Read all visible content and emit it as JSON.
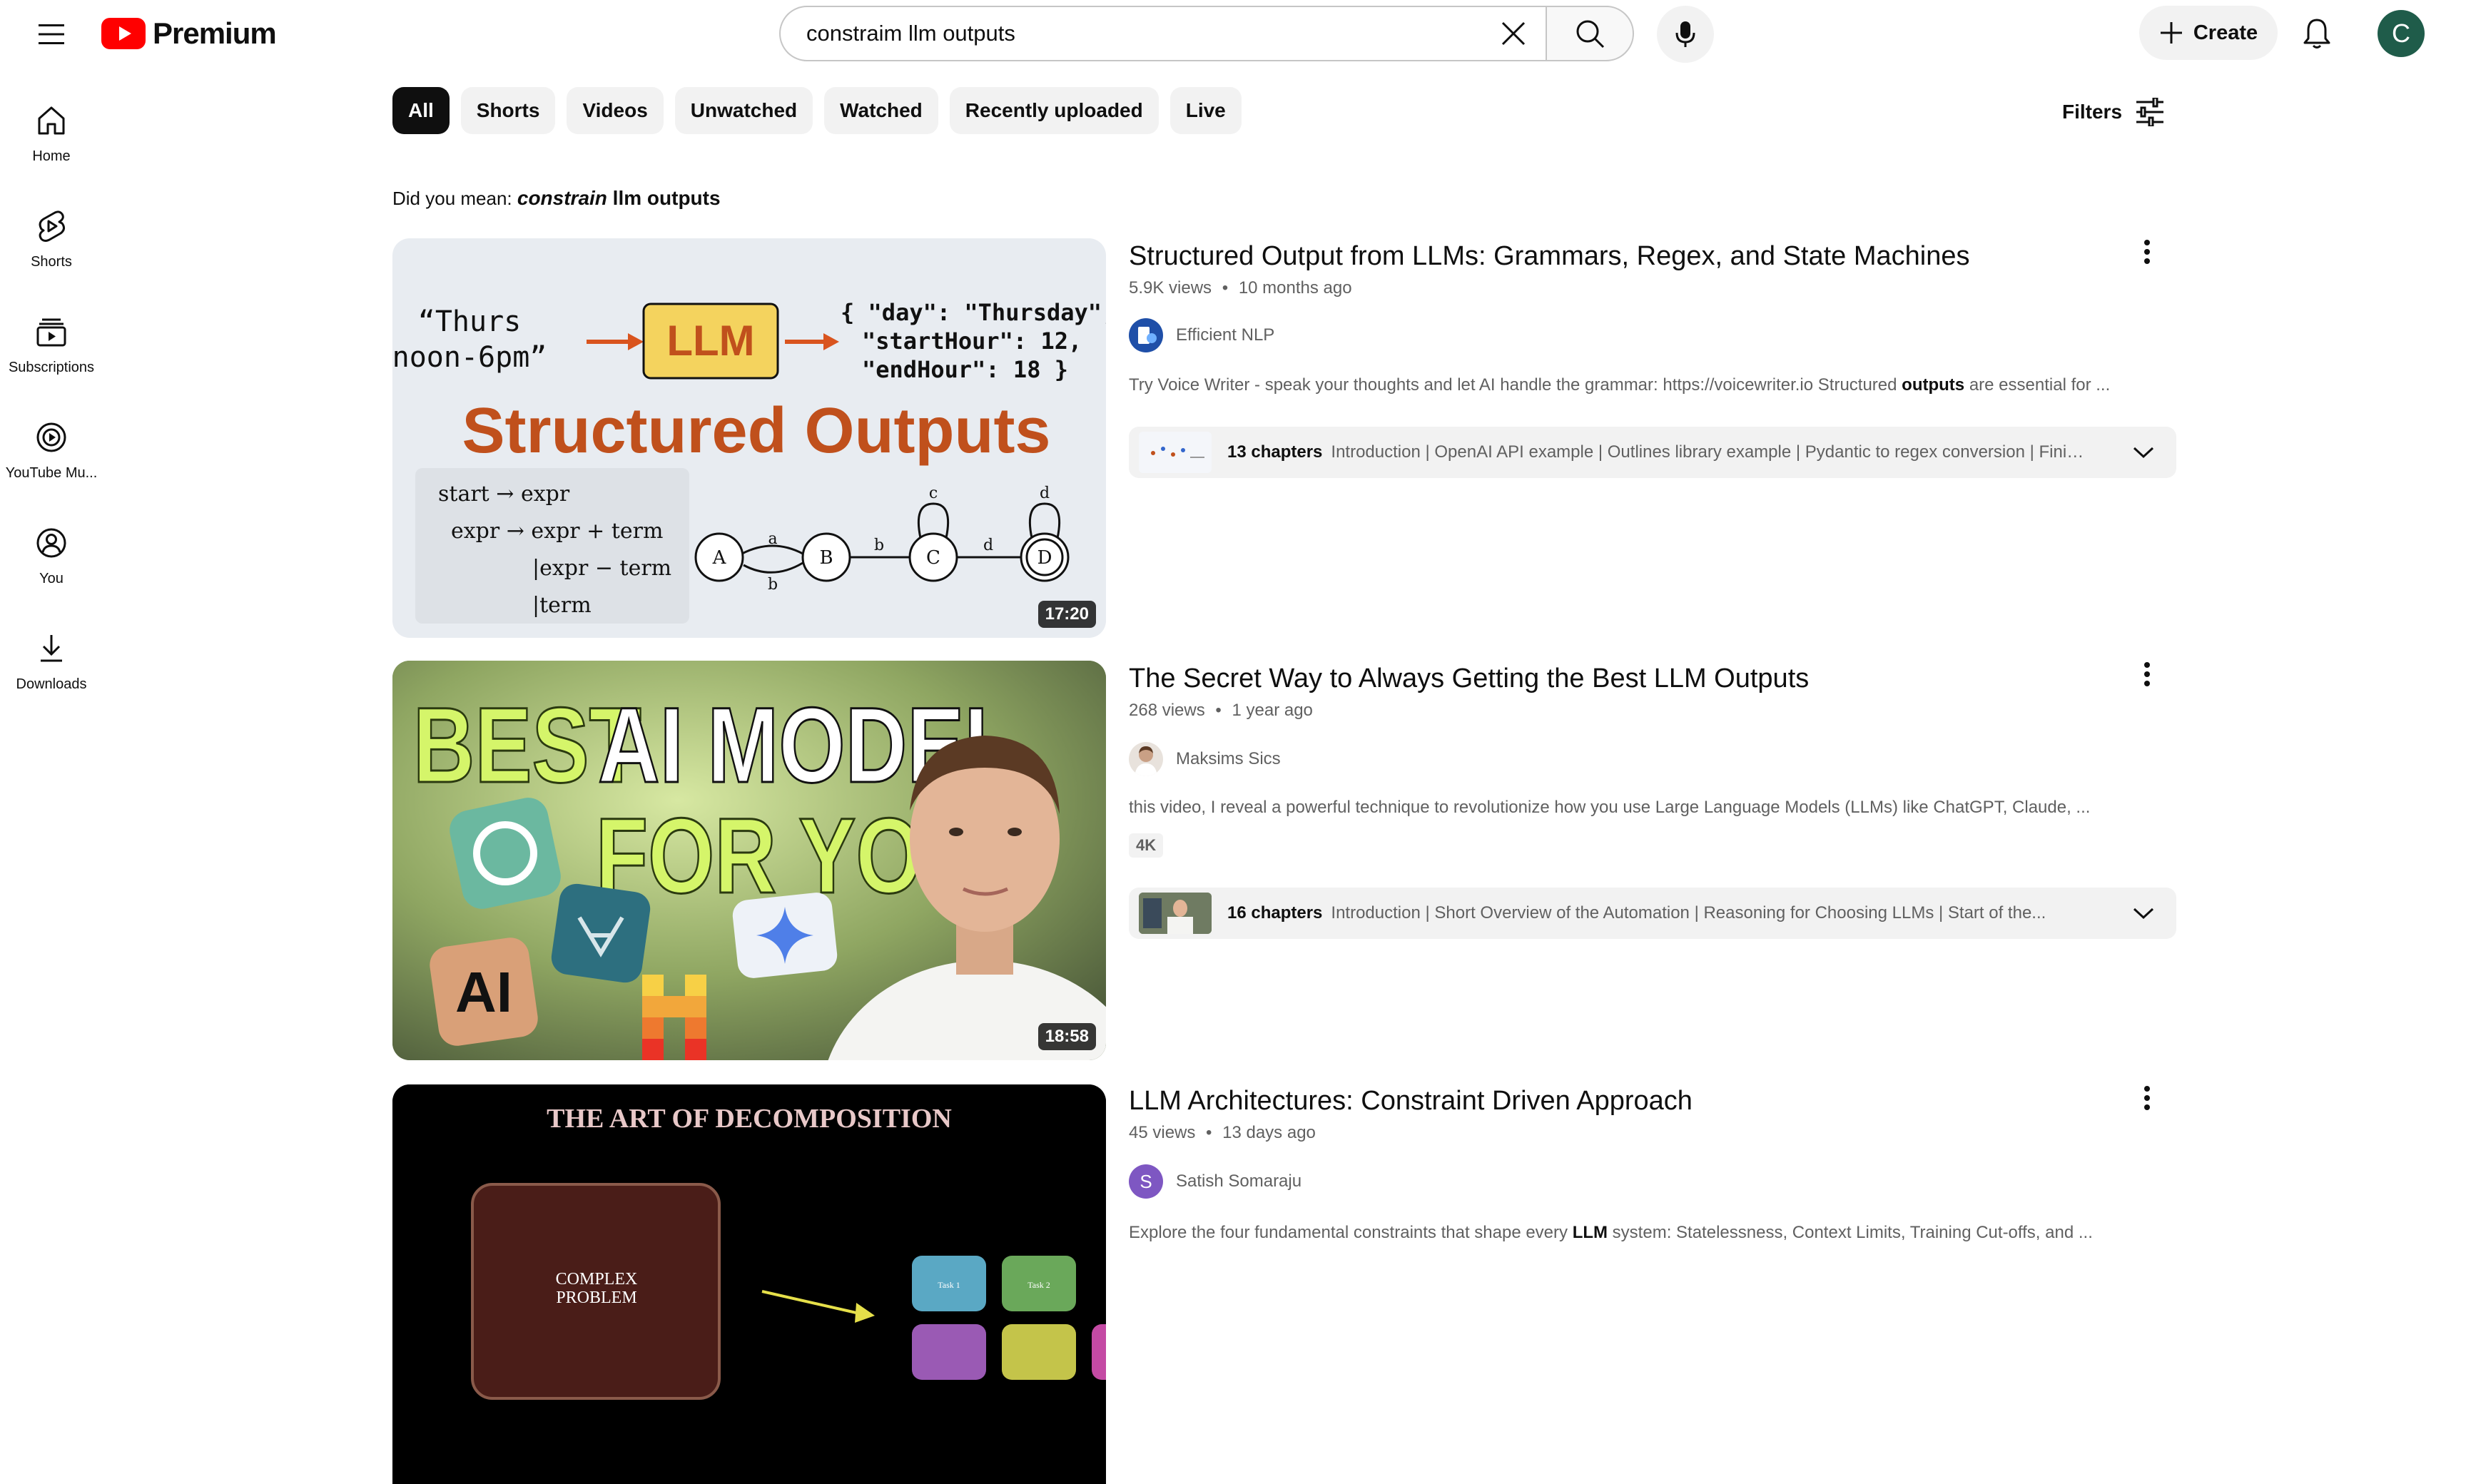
{
  "header": {
    "brand": "Premium",
    "search_value": "constraim llm outputs",
    "create_label": "Create",
    "avatar_letter": "C",
    "accent_red": "#ff0000"
  },
  "sidebar": {
    "items": [
      {
        "label": "Home",
        "icon": "home-icon"
      },
      {
        "label": "Shorts",
        "icon": "shorts-icon"
      },
      {
        "label": "Subscriptions",
        "icon": "subscriptions-icon"
      },
      {
        "label": "YouTube Mu...",
        "icon": "youtube-music-icon"
      },
      {
        "label": "You",
        "icon": "you-icon"
      },
      {
        "label": "Downloads",
        "icon": "download-icon"
      }
    ]
  },
  "chips": [
    "All",
    "Shorts",
    "Videos",
    "Unwatched",
    "Watched",
    "Recently uploaded",
    "Live"
  ],
  "filters_label": "Filters",
  "did_you_mean": {
    "prefix": "Did you mean: ",
    "corrected": "constrain",
    "rest": " llm outputs"
  },
  "results": [
    {
      "title": "Structured Output from LLMs: Grammars, Regex, and State Machines",
      "views": "5.9K views",
      "age": "10 months ago",
      "channel": "Efficient NLP",
      "desc_before": "Try Voice Writer - speak your thoughts and let AI handle the grammar: https://voicewriter.io Structured ",
      "desc_bold": "outputs",
      "desc_after": " are essential for ...",
      "duration": "17:20",
      "chapters_count": "13 chapters",
      "chapters_list": "Introduction | OpenAI API example | Outlines library example | Pydantic to regex conversion | Finite...",
      "thumb": {
        "quote_line1": "“Thurs",
        "quote_line2": "noon-6pm”",
        "llm": "LLM",
        "json_line1": "{ \"day\": \"Thursday\",",
        "json_line2": "\"startHour\": 12,",
        "json_line3": "\"endHour\": 18 }",
        "headline": "Structured Outputs",
        "g1": "start → expr",
        "g2": "expr → expr + term",
        "g3": "|expr − term",
        "g4": "|term",
        "nodes": [
          "A",
          "B",
          "C",
          "D"
        ],
        "edges": [
          "a",
          "b",
          "b",
          "d",
          "c",
          "d"
        ]
      }
    },
    {
      "title": "The Secret Way to Always Getting the Best LLM Outputs",
      "views": "268 views",
      "age": "1 year ago",
      "channel": "Maksims Sics",
      "desc_before": "this video, I reveal a powerful technique to revolutionize how you use Large Language Models (LLMs) like ChatGPT, Claude, ...",
      "desc_bold": "",
      "desc_after": "",
      "badge": "4K",
      "duration": "18:58",
      "chapters_count": "16 chapters",
      "chapters_list": "Introduction | Short Overview of the Automation | Reasoning for Choosing LLMs | Start of the...",
      "thumb": {
        "line1a": "BEST",
        "line1b": "AI MODEL",
        "line2": "FOR YOU",
        "ai_tile": "AI"
      }
    },
    {
      "title": "LLM Architectures: Constraint Driven Approach",
      "views": "45 views",
      "age": "13 days ago",
      "channel": "Satish Somaraju",
      "channel_initial": "S",
      "desc_before": "Explore the four fundamental constraints that shape every ",
      "desc_bold": "LLM",
      "desc_after": " system: Statelessness, Context Limits, Training Cut-offs, and ...",
      "thumb": {
        "heading": "THE ART OF DECOMPOSITION",
        "box1": "COMPLEX",
        "box2": "PROBLEM",
        "t1": "Task 1",
        "t2": "Task 2"
      }
    }
  ],
  "separator": "•"
}
